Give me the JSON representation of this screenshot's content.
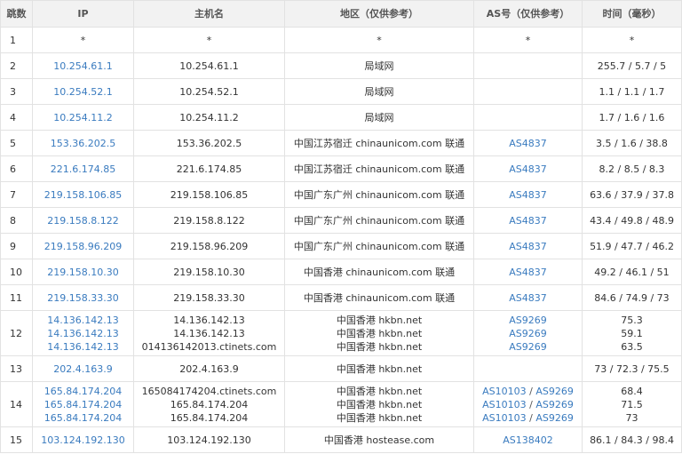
{
  "headers": {
    "hop": "跳数",
    "ip": "IP",
    "host": "主机名",
    "region": "地区（仅供参考）",
    "as": "AS号（仅供参考）",
    "time": "时间（毫秒）"
  },
  "rows": [
    {
      "hop": "1",
      "ips": [
        "*"
      ],
      "hosts": [
        "*"
      ],
      "regions": [
        "*"
      ],
      "as": [
        [
          "*"
        ]
      ],
      "times": [
        "*"
      ]
    },
    {
      "hop": "2",
      "ips": [
        "10.254.61.1"
      ],
      "hosts": [
        "10.254.61.1"
      ],
      "regions": [
        "局域网"
      ],
      "as": [
        []
      ],
      "times": [
        "255.7 / 5.7 / 5"
      ]
    },
    {
      "hop": "3",
      "ips": [
        "10.254.52.1"
      ],
      "hosts": [
        "10.254.52.1"
      ],
      "regions": [
        "局域网"
      ],
      "as": [
        []
      ],
      "times": [
        "1.1 / 1.1 / 1.7"
      ]
    },
    {
      "hop": "4",
      "ips": [
        "10.254.11.2"
      ],
      "hosts": [
        "10.254.11.2"
      ],
      "regions": [
        "局域网"
      ],
      "as": [
        []
      ],
      "times": [
        "1.7 / 1.6 / 1.6"
      ]
    },
    {
      "hop": "5",
      "ips": [
        "153.36.202.5"
      ],
      "hosts": [
        "153.36.202.5"
      ],
      "regions": [
        "中国江苏宿迁 chinaunicom.com 联通"
      ],
      "as": [
        [
          "AS4837"
        ]
      ],
      "times": [
        "3.5 / 1.6 / 38.8"
      ]
    },
    {
      "hop": "6",
      "ips": [
        "221.6.174.85"
      ],
      "hosts": [
        "221.6.174.85"
      ],
      "regions": [
        "中国江苏宿迁 chinaunicom.com 联通"
      ],
      "as": [
        [
          "AS4837"
        ]
      ],
      "times": [
        "8.2 / 8.5 / 8.3"
      ]
    },
    {
      "hop": "7",
      "ips": [
        "219.158.106.85"
      ],
      "hosts": [
        "219.158.106.85"
      ],
      "regions": [
        "中国广东广州 chinaunicom.com 联通"
      ],
      "as": [
        [
          "AS4837"
        ]
      ],
      "times": [
        "63.6 / 37.9 / 37.8"
      ]
    },
    {
      "hop": "8",
      "ips": [
        "219.158.8.122"
      ],
      "hosts": [
        "219.158.8.122"
      ],
      "regions": [
        "中国广东广州 chinaunicom.com 联通"
      ],
      "as": [
        [
          "AS4837"
        ]
      ],
      "times": [
        "43.4 / 49.8 / 48.9"
      ]
    },
    {
      "hop": "9",
      "ips": [
        "219.158.96.209"
      ],
      "hosts": [
        "219.158.96.209"
      ],
      "regions": [
        "中国广东广州 chinaunicom.com 联通"
      ],
      "as": [
        [
          "AS4837"
        ]
      ],
      "times": [
        "51.9 / 47.7 / 46.2"
      ]
    },
    {
      "hop": "10",
      "ips": [
        "219.158.10.30"
      ],
      "hosts": [
        "219.158.10.30"
      ],
      "regions": [
        "中国香港 chinaunicom.com 联通"
      ],
      "as": [
        [
          "AS4837"
        ]
      ],
      "times": [
        "49.2 / 46.1 / 51"
      ]
    },
    {
      "hop": "11",
      "ips": [
        "219.158.33.30"
      ],
      "hosts": [
        "219.158.33.30"
      ],
      "regions": [
        "中国香港 chinaunicom.com 联通"
      ],
      "as": [
        [
          "AS4837"
        ]
      ],
      "times": [
        "84.6 / 74.9 / 73"
      ]
    },
    {
      "hop": "12",
      "ips": [
        "14.136.142.13",
        "14.136.142.13",
        "14.136.142.13"
      ],
      "hosts": [
        "14.136.142.13",
        "14.136.142.13",
        "014136142013.ctinets.com"
      ],
      "regions": [
        "中国香港 hkbn.net",
        "中国香港 hkbn.net",
        "中国香港 hkbn.net"
      ],
      "as": [
        [
          "AS9269"
        ],
        [
          "AS9269"
        ],
        [
          "AS9269"
        ]
      ],
      "times": [
        "75.3",
        "59.1",
        "63.5"
      ]
    },
    {
      "hop": "13",
      "ips": [
        "202.4.163.9"
      ],
      "hosts": [
        "202.4.163.9"
      ],
      "regions": [
        "中国香港 hkbn.net"
      ],
      "as": [
        []
      ],
      "times": [
        "73 / 72.3 / 75.5"
      ]
    },
    {
      "hop": "14",
      "ips": [
        "165.84.174.204",
        "165.84.174.204",
        "165.84.174.204"
      ],
      "hosts": [
        "165084174204.ctinets.com",
        "165.84.174.204",
        "165.84.174.204"
      ],
      "regions": [
        "中国香港 hkbn.net",
        "中国香港 hkbn.net",
        "中国香港 hkbn.net"
      ],
      "as": [
        [
          "AS10103",
          "AS9269"
        ],
        [
          "AS10103",
          "AS9269"
        ],
        [
          "AS10103",
          "AS9269"
        ]
      ],
      "times": [
        "68.4",
        "71.5",
        "73"
      ]
    },
    {
      "hop": "15",
      "ips": [
        "103.124.192.130"
      ],
      "hosts": [
        "103.124.192.130"
      ],
      "regions": [
        "中国香港 hostease.com"
      ],
      "as": [
        [
          "AS138402"
        ]
      ],
      "times": [
        "86.1 / 84.3 / 98.4"
      ]
    }
  ]
}
